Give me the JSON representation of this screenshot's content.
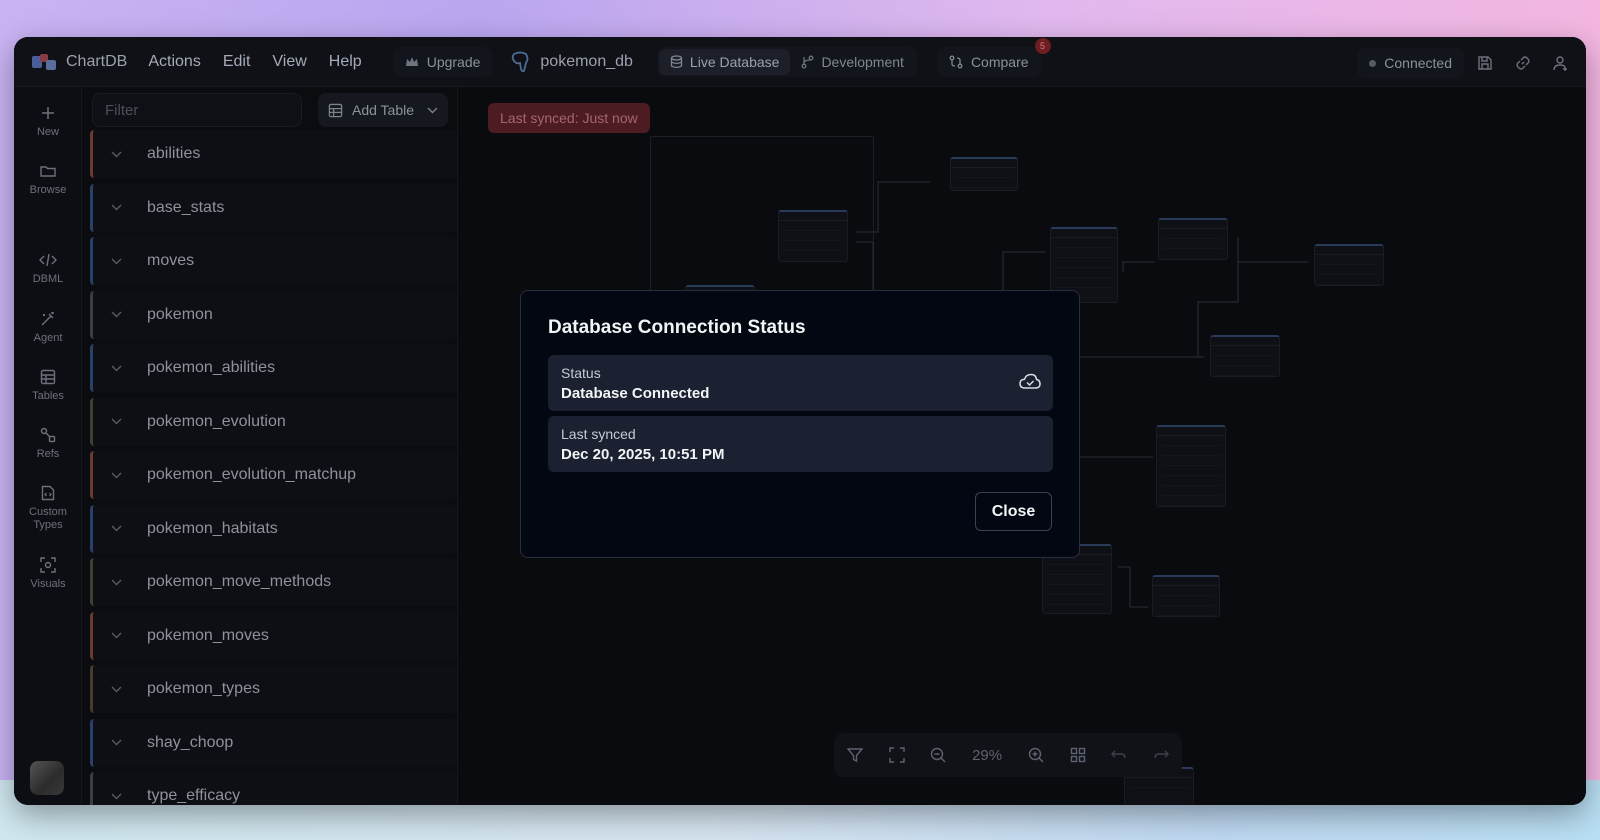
{
  "app": {
    "brand": "ChartDB",
    "menu": [
      "Actions",
      "Edit",
      "View",
      "Help"
    ],
    "upgrade_label": "Upgrade",
    "database_name": "pokemon_db",
    "env": {
      "live": "Live Database",
      "dev": "Development"
    },
    "compare_label": "Compare",
    "compare_badge": "5",
    "status_label": "Connected"
  },
  "rail": {
    "new": "New",
    "browse": "Browse",
    "dbml": "DBML",
    "agent": "Agent",
    "tables": "Tables",
    "refs": "Refs",
    "custom_types": "Custom Types",
    "visuals": "Visuals"
  },
  "sidebar": {
    "filter_placeholder": "Filter",
    "add_table_label": "Add Table",
    "tables": [
      {
        "name": "abilities",
        "color": "#6b3a33"
      },
      {
        "name": "base_stats",
        "color": "#2b3f6b"
      },
      {
        "name": "moves",
        "color": "#2b3f6b"
      },
      {
        "name": "pokemon",
        "color": "#3a3d45"
      },
      {
        "name": "pokemon_abilities",
        "color": "#2b3f6b"
      },
      {
        "name": "pokemon_evolution",
        "color": "#3b4232"
      },
      {
        "name": "pokemon_evolution_matchup",
        "color": "#6b3a33"
      },
      {
        "name": "pokemon_habitats",
        "color": "#2b3f6b"
      },
      {
        "name": "pokemon_move_methods",
        "color": "#3b4232"
      },
      {
        "name": "pokemon_moves",
        "color": "#6b3a33"
      },
      {
        "name": "pokemon_types",
        "color": "#4a3a2a"
      },
      {
        "name": "shay_choop",
        "color": "#2b3f6b"
      },
      {
        "name": "type_efficacy",
        "color": "#3a3d45"
      }
    ]
  },
  "canvas": {
    "synced_pill": "Last synced: Just now",
    "zoom": "29%"
  },
  "modal": {
    "title": "Database Connection Status",
    "status_label": "Status",
    "status_value": "Database Connected",
    "synced_label": "Last synced",
    "synced_value": "Dec 20, 2025, 10:51 PM",
    "close_label": "Close"
  }
}
